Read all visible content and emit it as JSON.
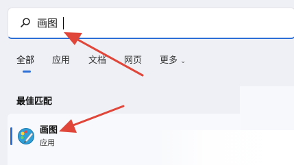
{
  "search": {
    "query": "画图"
  },
  "tabs": [
    {
      "label": "全部",
      "active": true
    },
    {
      "label": "应用",
      "active": false
    },
    {
      "label": "文档",
      "active": false
    },
    {
      "label": "网页",
      "active": false
    },
    {
      "label": "更多",
      "active": false
    }
  ],
  "section": {
    "title": "最佳匹配"
  },
  "best_match": {
    "name": "画图",
    "type": "应用",
    "icon": "paint-app-icon"
  },
  "colors": {
    "accent": "#2b6fd6",
    "annotation_arrow": "#e0473a"
  }
}
